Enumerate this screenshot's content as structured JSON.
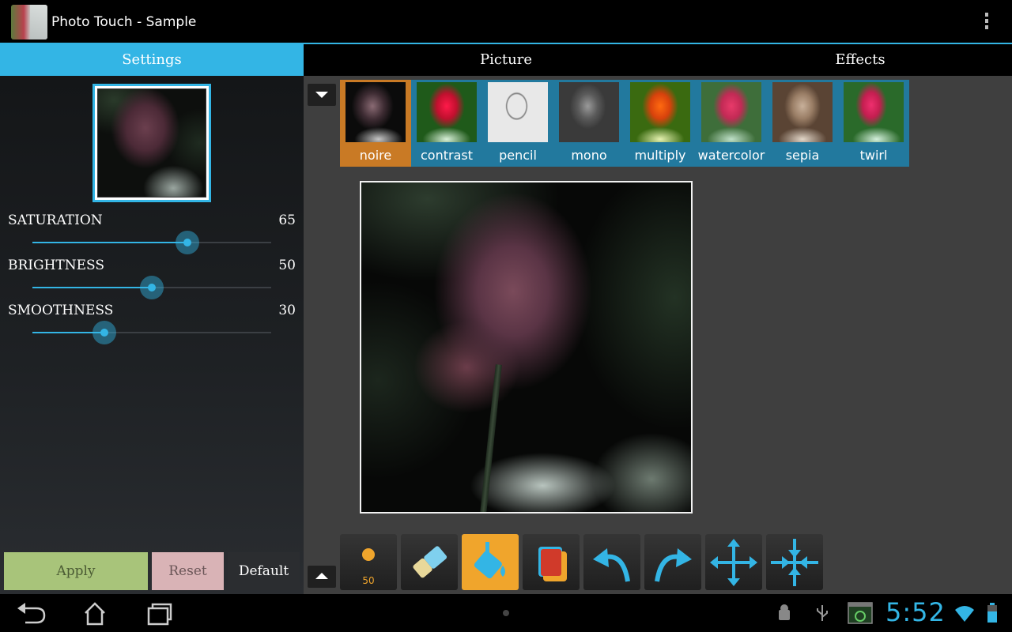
{
  "app": {
    "title": "Photo Touch - Sample"
  },
  "tabs": [
    {
      "label": "Settings",
      "active": true
    },
    {
      "label": "Picture",
      "active": false
    },
    {
      "label": "Effects",
      "active": false
    }
  ],
  "settings": {
    "sliders": [
      {
        "label": "SATURATION",
        "value": "65",
        "fraction": 0.65
      },
      {
        "label": "BRIGHTNESS",
        "value": "50",
        "fraction": 0.5
      },
      {
        "label": "SMOOTHNESS",
        "value": "30",
        "fraction": 0.3
      }
    ],
    "buttons": {
      "apply": "Apply",
      "reset": "Reset",
      "default": "Default"
    }
  },
  "effects": {
    "selected": "noire",
    "items": [
      {
        "label": "noire"
      },
      {
        "label": "contrast"
      },
      {
        "label": "pencil"
      },
      {
        "label": "mono"
      },
      {
        "label": "multiply"
      },
      {
        "label": "watercolor"
      },
      {
        "label": "sepia"
      },
      {
        "label": "twirl"
      }
    ]
  },
  "toolbar": {
    "brush_size": "50",
    "tools": [
      "brush-size",
      "eraser",
      "fill-bucket",
      "layers",
      "undo",
      "redo",
      "move",
      "fit"
    ],
    "active_tool": "fill-bucket"
  },
  "statusbar": {
    "time": "5:52"
  },
  "colors": {
    "accent": "#33b5e5",
    "selected_effect": "#c97a25",
    "active_tool": "#f0a52c"
  }
}
